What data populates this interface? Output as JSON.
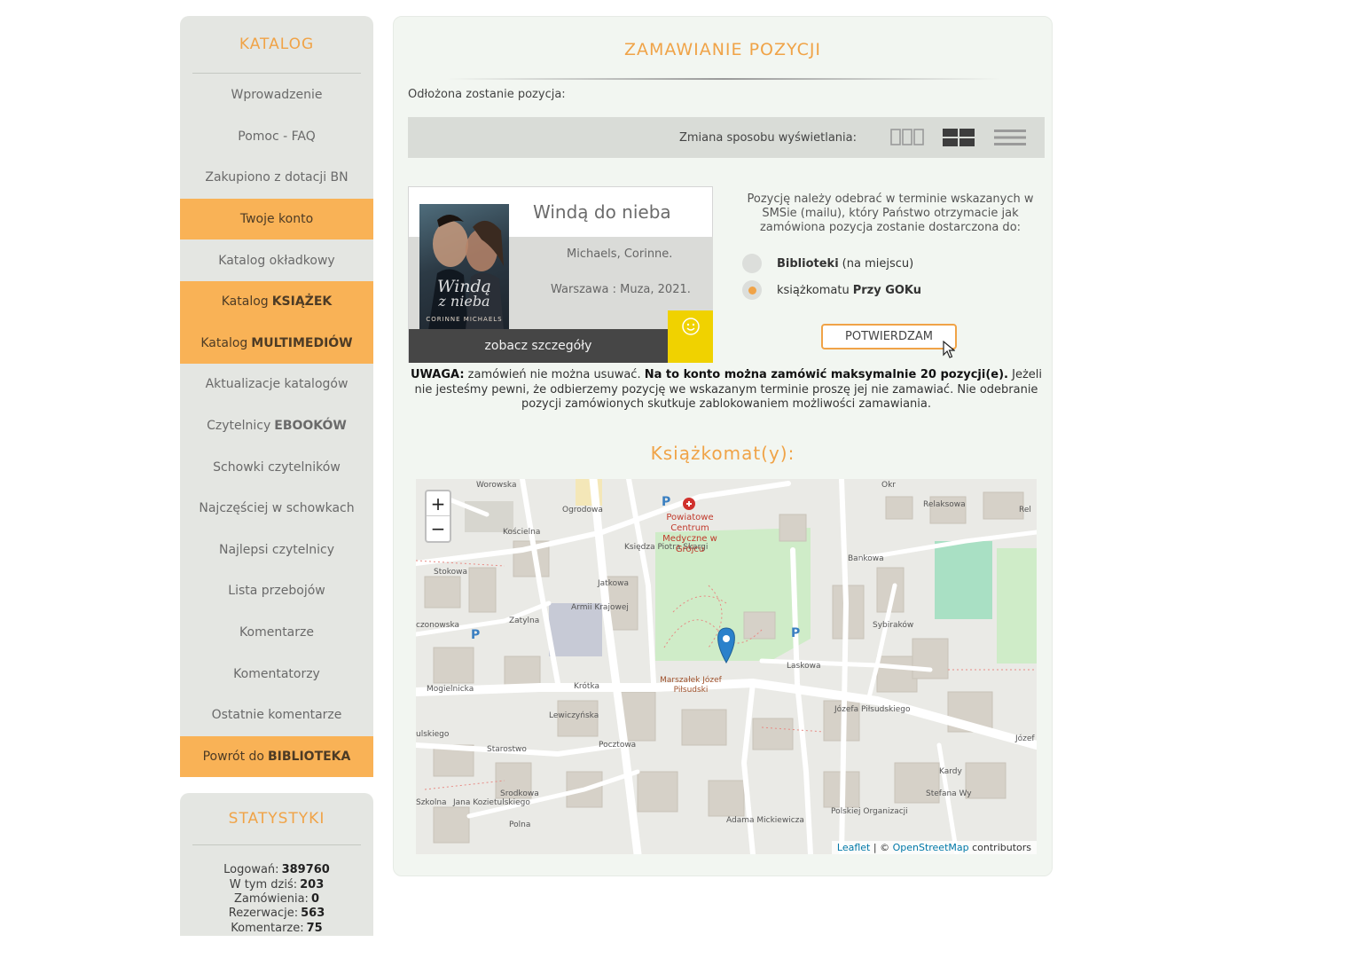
{
  "sidebar": {
    "title": "KATALOG",
    "items": [
      {
        "label": "Wprowadzenie",
        "bold": ""
      },
      {
        "label": "Pomoc - FAQ",
        "bold": ""
      },
      {
        "label": "Zakupiono z dotacji BN",
        "bold": ""
      },
      {
        "label": "Twoje konto",
        "bold": ""
      },
      {
        "label": "Katalog okładkowy",
        "bold": ""
      },
      {
        "label": "Katalog",
        "bold": "KSIĄŻEK"
      },
      {
        "label": "Katalog",
        "bold": "MULTIMEDIÓW"
      },
      {
        "label": "Aktualizacje katalogów",
        "bold": ""
      },
      {
        "label": "Czytelnicy",
        "bold": "EBOOKÓW"
      },
      {
        "label": "Schowki czytelników",
        "bold": ""
      },
      {
        "label": "Najczęściej w schowkach",
        "bold": ""
      },
      {
        "label": "Najlepsi czytelnicy",
        "bold": ""
      },
      {
        "label": "Lista przebojów",
        "bold": ""
      },
      {
        "label": "Komentarze",
        "bold": ""
      },
      {
        "label": "Komentatorzy",
        "bold": ""
      },
      {
        "label": "Ostatnie komentarze",
        "bold": ""
      },
      {
        "label": "Powrót do",
        "bold": "BIBLIOTEKA"
      }
    ]
  },
  "stats": {
    "title": "STATYSTYKI",
    "rows": [
      {
        "label": "Logowań:",
        "value": "389760"
      },
      {
        "label": "W tym dziś:",
        "value": "203"
      },
      {
        "label": "Zamówienia:",
        "value": "0"
      },
      {
        "label": "Rezerwacje:",
        "value": "563"
      },
      {
        "label": "Komentarze:",
        "value": "75"
      }
    ]
  },
  "main": {
    "title": "ZAMAWIANIE POZYCJI",
    "reserved_label": "Odłożona zostanie pozycja:",
    "view_label": "Zmiana sposobu wyświetlania:"
  },
  "book": {
    "title": "Windą do nieba",
    "author": "Michaels, Corinne.",
    "publication": "Warszawa : Muza, 2021.",
    "cover_title": "Windą",
    "cover_subtitle": "z nieba",
    "cover_author": "CORINNE MICHAELS",
    "details_label": "zobacz szczegóły"
  },
  "pickup": {
    "info": "Pozycję należy odebrać w terminie wskazanych w SMSie (mailu), który Państwo otrzymacie jak zamówiona pozycja zostanie dostarczona do:",
    "options": [
      {
        "bold": "Biblioteki",
        "rest": "(na miejscu)",
        "bold_after": "",
        "selected": false
      },
      {
        "bold": "",
        "rest": "książkomatu",
        "bold_after": "Przy GOKu",
        "selected": true
      }
    ],
    "confirm_label": "POTWIERDZAM"
  },
  "warning": {
    "b1": "UWAGA:",
    "t1": " zamówień nie można usuwać. ",
    "b2": "Na to konto można zamówić maksymalnie 20 pozycji(e).",
    "t2": " Jeżeli nie jesteśmy pewni, że odbierzemy pozycję we wskazanym terminie proszę jej nie zamawiać. Nie odebranie pozycji zamówionych skutkuje zablokowaniem możliwości zamawiania."
  },
  "map": {
    "title": "Książkomat(y):",
    "zoom_in": "+",
    "zoom_out": "−",
    "attribution_leaflet": "Leaflet",
    "attribution_sep": " | © ",
    "attribution_osm": "OpenStreetMap",
    "attribution_rest": " contributors",
    "poi": "Powiatowe Centrum Medyczne w Grójcu",
    "monument": "Marszałek Józef Piłsudski",
    "streets": [
      "Worowska",
      "Relaksowa",
      "Rel",
      "Stokowa",
      "Kościelna",
      "Jatkowa",
      "Księdza Piotra Skargi",
      "Bankowa",
      "Armii Krajowej",
      "Zatylna",
      "Laskowa",
      "Sybiraków",
      "Mogielnicka",
      "Krótka",
      "Józefa Piłsudskiego",
      "Lewiczyńska",
      "Józef",
      "Starostwo",
      "Pocztowa",
      "Srodkowa",
      "Polna",
      "Jana Kozietulskiego",
      "Adama Mickiewicza",
      "Polskiej Organizacji",
      "Stefana Wy",
      "Kardy",
      "czonowska",
      "ulskiego",
      "Szkolna",
      "Ogrodowa",
      "Okr"
    ]
  },
  "colors": {
    "accent": "#f0a347",
    "highlight": "#f9b256",
    "sidebar_bg": "#e4e6e2",
    "main_bg": "#f2f6f1",
    "details_bg": "#464646",
    "smile_bg": "#f0d200"
  },
  "icons": [
    "grid-three-icon",
    "grid-four-icon",
    "list-icon",
    "smile-icon",
    "map-marker-icon",
    "parking-icon",
    "hospital-icon",
    "cursor-icon"
  ]
}
